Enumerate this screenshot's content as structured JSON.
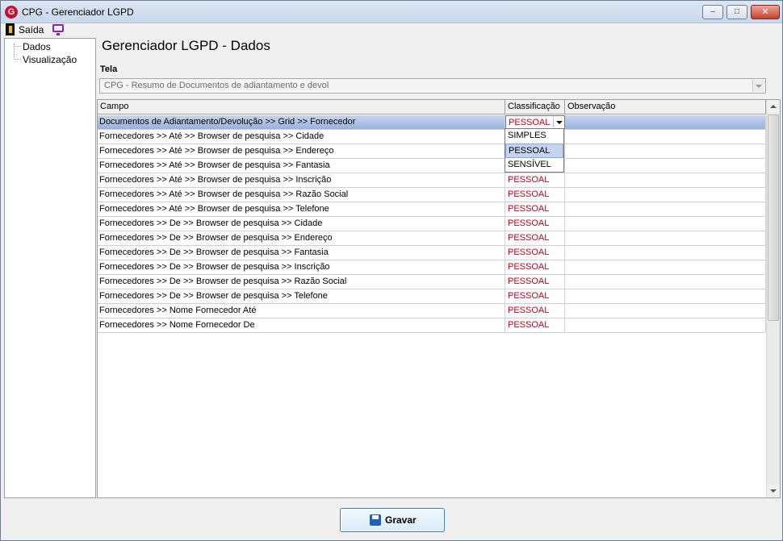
{
  "window": {
    "title": "CPG - Gerenciador LGPD",
    "icon_letter": "G",
    "minimize_glyph": "–",
    "maximize_glyph": "□",
    "close_glyph": "✕"
  },
  "menu": {
    "exit_label": "Saída",
    "exit_icon": "door-exit-icon",
    "monitor_icon": "monitor-icon"
  },
  "tree": {
    "items": [
      {
        "label": "Dados"
      },
      {
        "label": "Visualização"
      }
    ]
  },
  "main": {
    "title": "Gerenciador LGPD - Dados",
    "tela_label": "Tela",
    "tela_value": "CPG - Resumo de Documentos de adiantamento e devol"
  },
  "grid": {
    "headers": {
      "campo": "Campo",
      "classificacao": "Classificação",
      "observacao": "Observação"
    },
    "rows": [
      {
        "campo": "Documentos de Adiantamento/Devolução >> Grid >> Fornecedor",
        "classificacao": "PESSOAL",
        "observacao": ""
      },
      {
        "campo": "Fornecedores >> Até >> Browser de pesquisa >> Cidade",
        "classificacao": "",
        "observacao": ""
      },
      {
        "campo": "Fornecedores >> Até >> Browser de pesquisa >> Endereço",
        "classificacao": "",
        "observacao": ""
      },
      {
        "campo": "Fornecedores >> Até >> Browser de pesquisa >> Fantasia",
        "classificacao": "",
        "observacao": ""
      },
      {
        "campo": "Fornecedores >> Até >> Browser de pesquisa >> Inscrição",
        "classificacao": "PESSOAL",
        "observacao": ""
      },
      {
        "campo": "Fornecedores >> Até >> Browser de pesquisa >> Razão Social",
        "classificacao": "PESSOAL",
        "observacao": ""
      },
      {
        "campo": "Fornecedores >> Até >> Browser de pesquisa >> Telefone",
        "classificacao": "PESSOAL",
        "observacao": ""
      },
      {
        "campo": "Fornecedores >> De >> Browser de pesquisa >> Cidade",
        "classificacao": "PESSOAL",
        "observacao": ""
      },
      {
        "campo": "Fornecedores >> De >> Browser de pesquisa >> Endereço",
        "classificacao": "PESSOAL",
        "observacao": ""
      },
      {
        "campo": "Fornecedores >> De >> Browser de pesquisa >> Fantasia",
        "classificacao": "PESSOAL",
        "observacao": ""
      },
      {
        "campo": "Fornecedores >> De >> Browser de pesquisa >> Inscrição",
        "classificacao": "PESSOAL",
        "observacao": ""
      },
      {
        "campo": "Fornecedores >> De >> Browser de pesquisa >> Razão Social",
        "classificacao": "PESSOAL",
        "observacao": ""
      },
      {
        "campo": "Fornecedores >> De >> Browser de pesquisa >> Telefone",
        "classificacao": "PESSOAL",
        "observacao": ""
      },
      {
        "campo": "Fornecedores >> Nome Fornecedor Até",
        "classificacao": "PESSOAL",
        "observacao": ""
      },
      {
        "campo": "Fornecedores >> Nome Fornecedor De",
        "classificacao": "PESSOAL",
        "observacao": ""
      }
    ],
    "dropdown_options": [
      "SIMPLES",
      "PESSOAL",
      "SENSÍVEL"
    ],
    "dropdown_highlighted": "PESSOAL"
  },
  "footer": {
    "save_label": "Gravar",
    "save_icon": "floppy-disk-icon"
  },
  "colors": {
    "classification_text": "#c0001a",
    "selected_row": "#99b0dd",
    "accent_button_border": "#3c7fb1"
  }
}
